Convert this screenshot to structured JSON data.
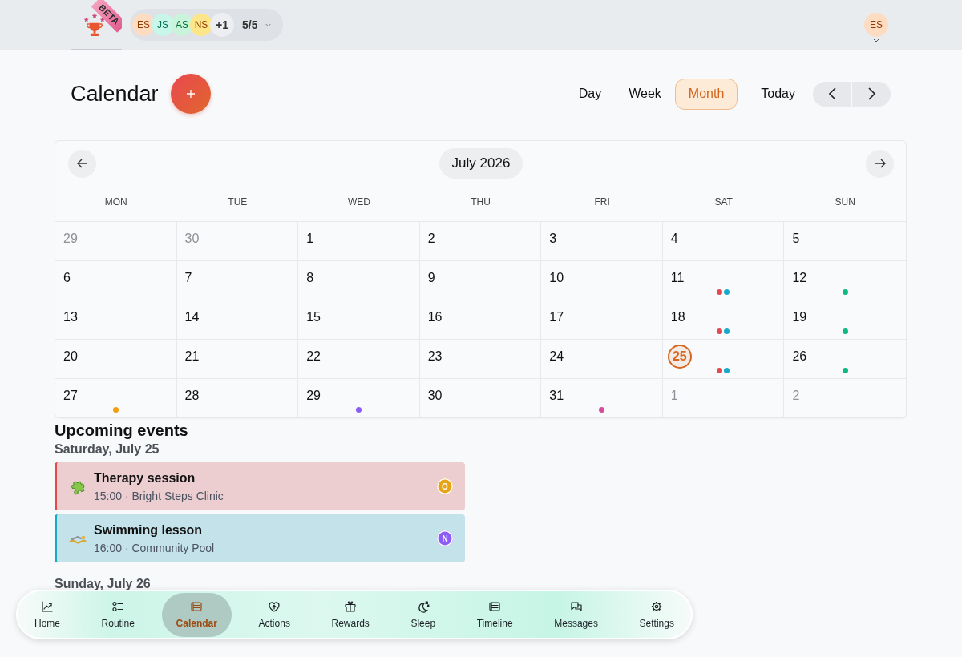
{
  "header": {
    "logo": {
      "badge": "BETA"
    },
    "members": {
      "avatars": [
        {
          "initials": "ES",
          "color": "#fddcc2"
        },
        {
          "initials": "JS",
          "color": "#c8f6e8"
        },
        {
          "initials": "AS",
          "color": "#c9f3da"
        },
        {
          "initials": "NS",
          "color": "#fde68a"
        }
      ],
      "more": "+1",
      "count": "5/5"
    },
    "user": {
      "initials": "ES",
      "color": "#fddcc2"
    }
  },
  "page": {
    "title": "Calendar",
    "views": [
      {
        "label": "Day",
        "selected": false
      },
      {
        "label": "Week",
        "selected": false
      },
      {
        "label": "Month",
        "selected": true
      }
    ],
    "today": "Today"
  },
  "calendar": {
    "month": "July 2026",
    "weekdays": [
      "MON",
      "TUE",
      "WED",
      "THU",
      "FRI",
      "SAT",
      "SUN"
    ],
    "weeks": [
      [
        {
          "day": "29",
          "outside_month": true,
          "today": false
        },
        {
          "day": "30",
          "outside_month": true,
          "today": false
        },
        {
          "day": "1",
          "outside_month": false,
          "today": false
        },
        {
          "day": "2",
          "outside_month": false,
          "today": false
        },
        {
          "day": "3",
          "outside_month": false,
          "today": false
        },
        {
          "day": "4",
          "outside_month": false,
          "today": false
        },
        {
          "day": "5",
          "outside_month": false,
          "today": false
        }
      ],
      [
        {
          "day": "6",
          "outside_month": false,
          "today": false
        },
        {
          "day": "7",
          "outside_month": false,
          "today": false
        },
        {
          "day": "8",
          "outside_month": false,
          "today": false
        },
        {
          "day": "9",
          "outside_month": false,
          "today": false
        },
        {
          "day": "10",
          "outside_month": false,
          "today": false
        },
        {
          "day": "11",
          "outside_month": false,
          "today": false,
          "dots": [
            {
              "color": "#e5484d"
            },
            {
              "color": "#17a9c9"
            }
          ]
        },
        {
          "day": "12",
          "outside_month": false,
          "today": false,
          "dots": [
            {
              "color": "#10b981"
            }
          ]
        }
      ],
      [
        {
          "day": "13",
          "outside_month": false,
          "today": false
        },
        {
          "day": "14",
          "outside_month": false,
          "today": false
        },
        {
          "day": "15",
          "outside_month": false,
          "today": false
        },
        {
          "day": "16",
          "outside_month": false,
          "today": false
        },
        {
          "day": "17",
          "outside_month": false,
          "today": false
        },
        {
          "day": "18",
          "outside_month": false,
          "today": false,
          "dots": [
            {
              "color": "#e5484d"
            },
            {
              "color": "#17a9c9"
            }
          ]
        },
        {
          "day": "19",
          "outside_month": false,
          "today": false,
          "dots": [
            {
              "color": "#10b981"
            }
          ]
        }
      ],
      [
        {
          "day": "20",
          "outside_month": false,
          "today": false
        },
        {
          "day": "21",
          "outside_month": false,
          "today": false
        },
        {
          "day": "22",
          "outside_month": false,
          "today": false
        },
        {
          "day": "23",
          "outside_month": false,
          "today": false
        },
        {
          "day": "24",
          "outside_month": false,
          "today": false
        },
        {
          "day": "25",
          "outside_month": false,
          "today": true,
          "dots": [
            {
              "color": "#e5484d"
            },
            {
              "color": "#17a9c9"
            }
          ]
        },
        {
          "day": "26",
          "outside_month": false,
          "today": false,
          "dots": [
            {
              "color": "#10b981"
            }
          ]
        }
      ],
      [
        {
          "day": "27",
          "outside_month": false,
          "today": false,
          "dots": [
            {
              "color": "#f59e0b"
            }
          ]
        },
        {
          "day": "28",
          "outside_month": false,
          "today": false
        },
        {
          "day": "29",
          "outside_month": false,
          "today": false,
          "dots": [
            {
              "color": "#8b5cf6"
            }
          ]
        },
        {
          "day": "30",
          "outside_month": false,
          "today": false
        },
        {
          "day": "31",
          "outside_month": false,
          "today": false,
          "dots": [
            {
              "color": "#db4a9a"
            }
          ]
        },
        {
          "day": "1",
          "outside_month": true,
          "today": false
        },
        {
          "day": "2",
          "outside_month": true,
          "today": false
        }
      ]
    ]
  },
  "upcoming": {
    "title": "Upcoming events",
    "days": [
      {
        "label": "Saturday, July 25",
        "events": [
          {
            "title": "Therapy session",
            "details": "15:00 · Bright Steps Clinic",
            "color": "#e5484d",
            "assignee": {
              "initial": "O",
              "color": "#e8a317"
            }
          },
          {
            "title": "Swimming lesson",
            "details": "16:00 · Community Pool",
            "color": "#17a9c9",
            "assignee": {
              "initial": "N",
              "color": "#8b5cf6"
            }
          }
        ]
      },
      {
        "label": "Sunday, July 26"
      }
    ]
  },
  "bottom_nav": {
    "items": [
      {
        "label": "Home",
        "selected": false
      },
      {
        "label": "Routine",
        "selected": false
      },
      {
        "label": "Calendar",
        "selected": true
      },
      {
        "label": "Actions",
        "selected": false
      },
      {
        "label": "Rewards",
        "selected": false
      },
      {
        "label": "Sleep",
        "selected": false
      },
      {
        "label": "Timeline",
        "selected": false
      },
      {
        "label": "Messages",
        "selected": false
      },
      {
        "label": "Settings",
        "selected": false
      }
    ]
  }
}
